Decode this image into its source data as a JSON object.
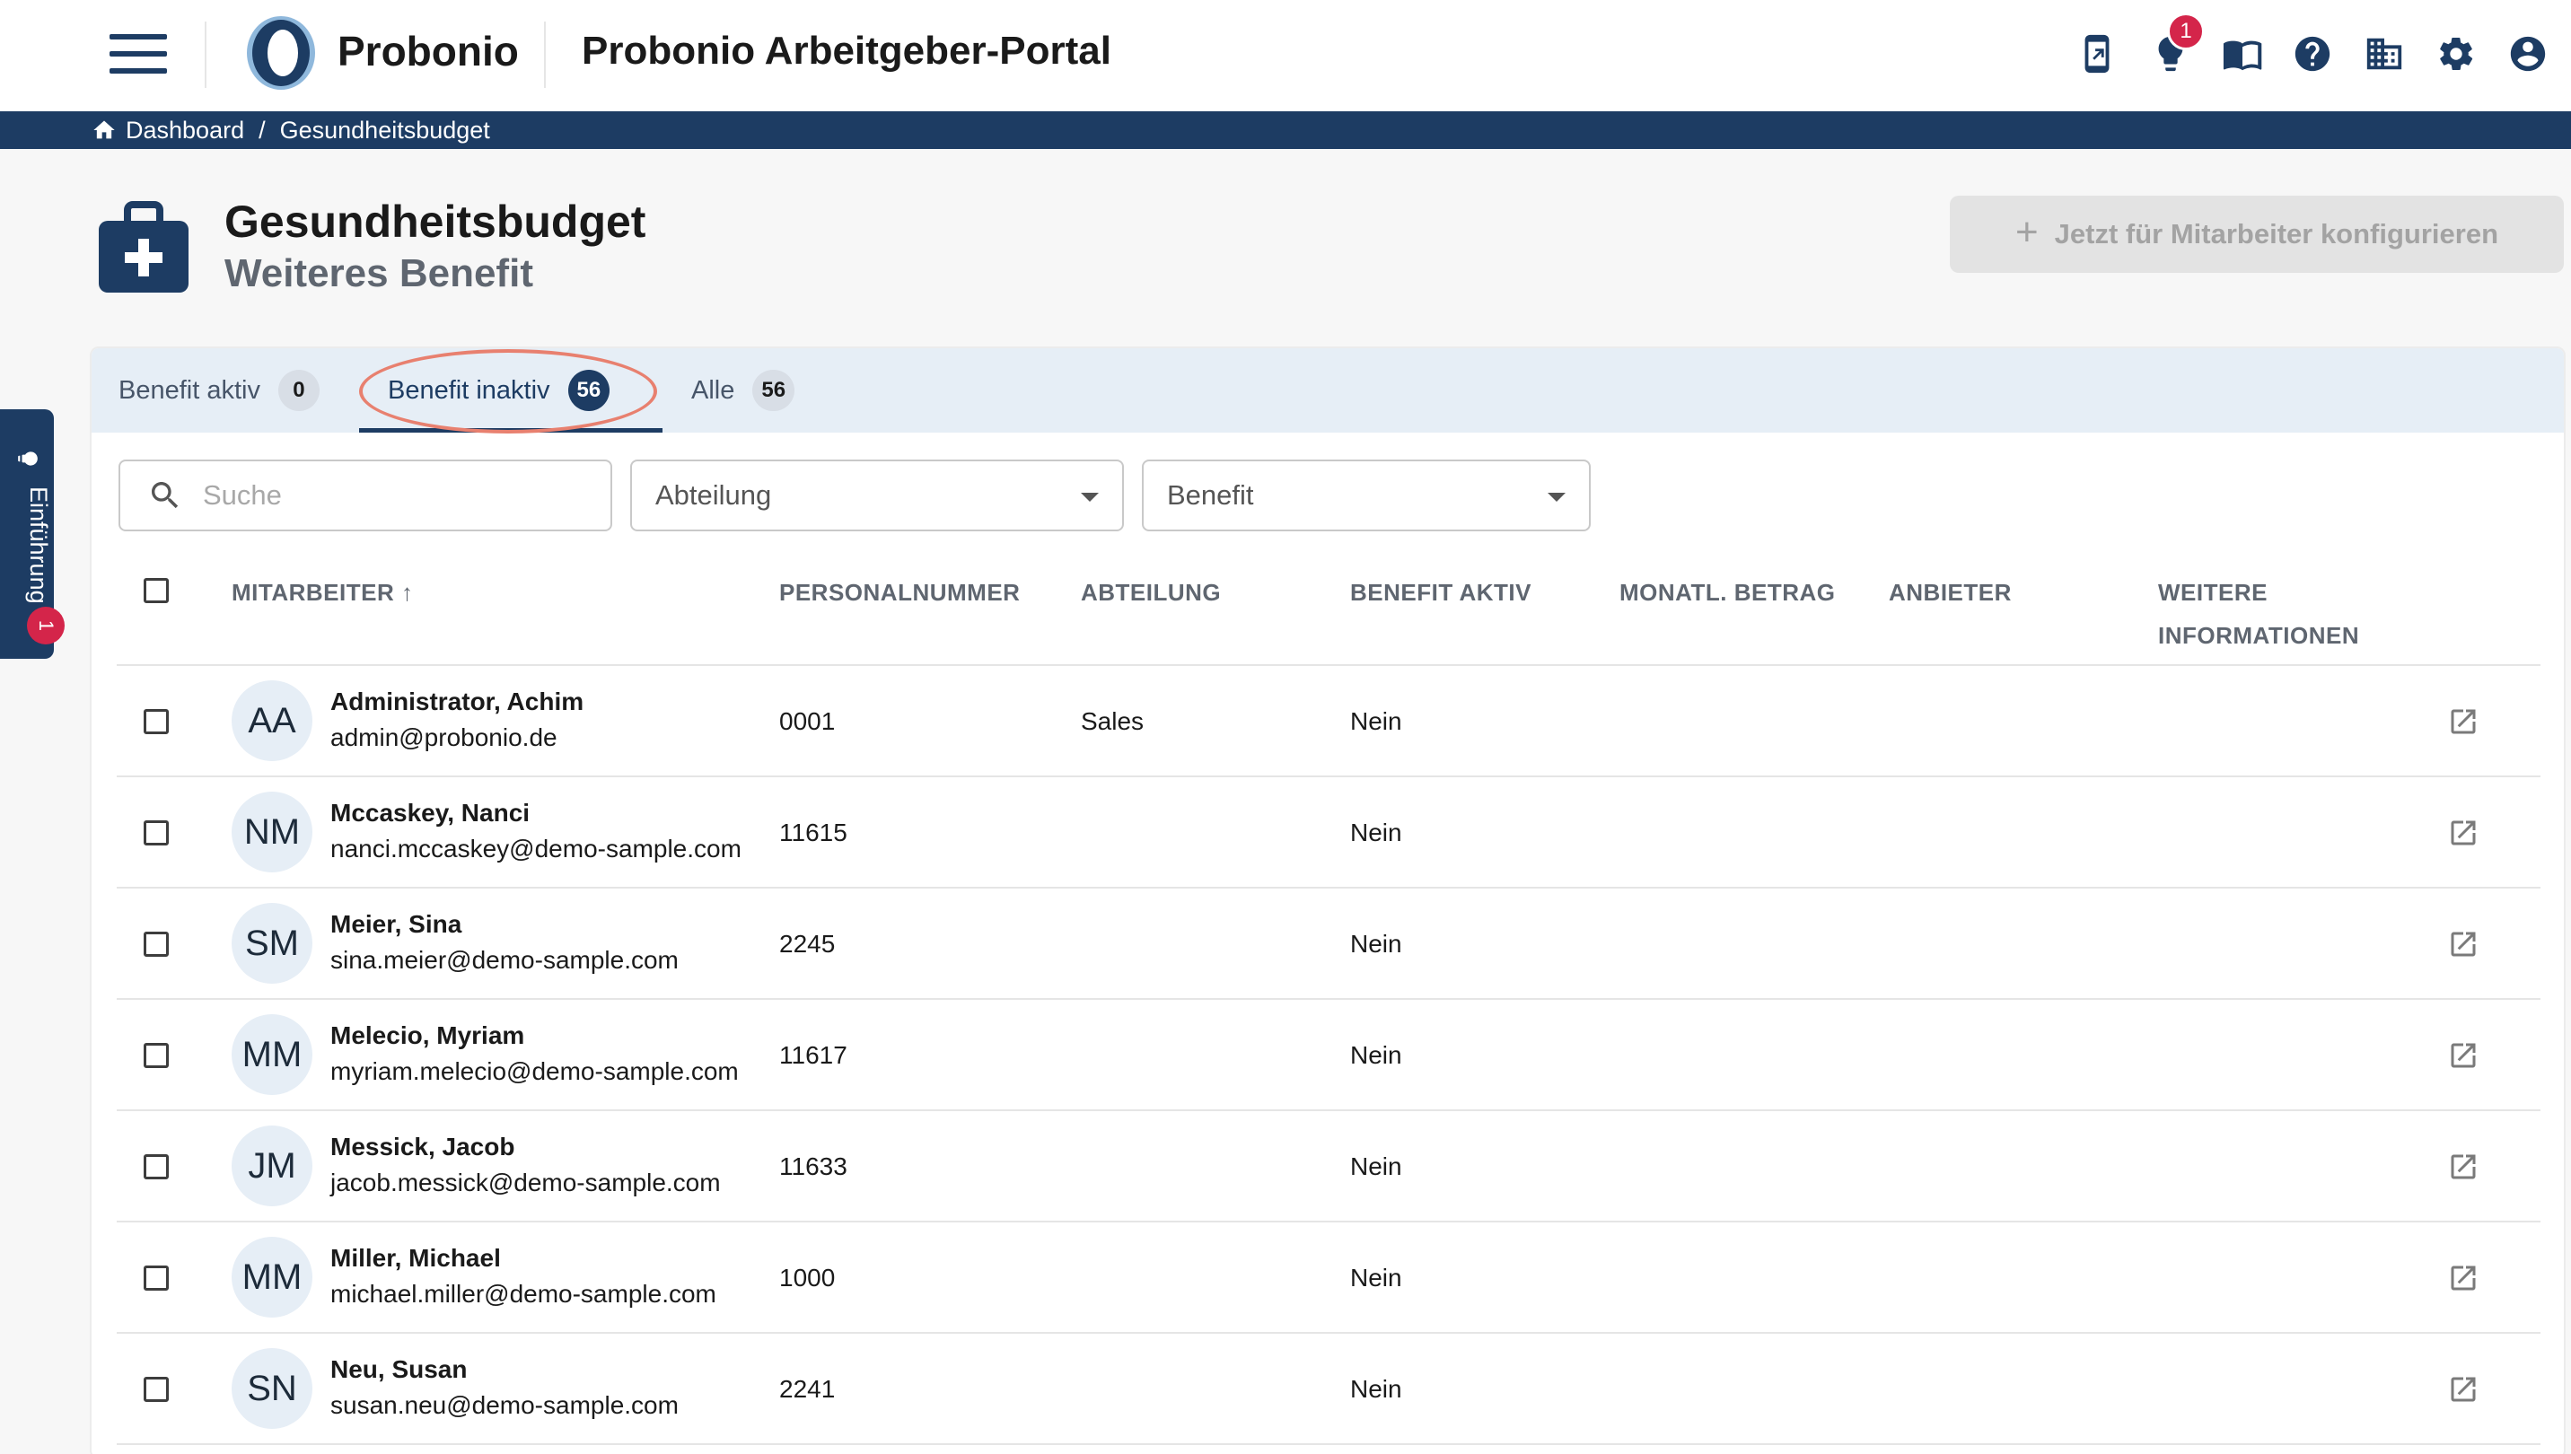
{
  "header": {
    "brand": "Probonio",
    "portal_title": "Probonio Arbeitgeber-Portal",
    "notification_count": "1",
    "icons": [
      "mobile-app-icon",
      "lightbulb-icon",
      "book-icon",
      "help-icon",
      "company-icon",
      "settings-icon",
      "account-icon"
    ]
  },
  "breadcrumb": {
    "home": "Dashboard",
    "separator": "/",
    "current": "Gesundheitsbudget"
  },
  "page": {
    "title": "Gesundheitsbudget",
    "subtitle": "Weiteres Benefit",
    "config_button": "Jetzt für Mitarbeiter konfigurieren",
    "config_button_icon": "+"
  },
  "tabs": [
    {
      "label": "Benefit aktiv",
      "count": "0",
      "active": false
    },
    {
      "label": "Benefit inaktiv",
      "count": "56",
      "active": true
    },
    {
      "label": "Alle",
      "count": "56",
      "active": false
    }
  ],
  "filters": {
    "search_placeholder": "Suche",
    "department": "Abteilung",
    "benefit": "Benefit"
  },
  "table": {
    "columns": [
      "MITARBEITER",
      "PERSONALNUMMER",
      "ABTEILUNG",
      "BENEFIT AKTIV",
      "MONATL. BETRAG",
      "ANBIETER",
      "WEITERE",
      "INFORMATIONEN"
    ],
    "sort_indicator": "↑",
    "rows": [
      {
        "initials": "AA",
        "name": "Administrator, Achim",
        "email": "admin@probonio.de",
        "personal_number": "0001",
        "department": "Sales",
        "benefit_active": "Nein"
      },
      {
        "initials": "NM",
        "name": "Mccaskey, Nanci",
        "email": "nanci.mccaskey@demo-sample.com",
        "personal_number": "11615",
        "department": "",
        "benefit_active": "Nein"
      },
      {
        "initials": "SM",
        "name": "Meier, Sina",
        "email": "sina.meier@demo-sample.com",
        "personal_number": "2245",
        "department": "",
        "benefit_active": "Nein"
      },
      {
        "initials": "MM",
        "name": "Melecio, Myriam",
        "email": "myriam.melecio@demo-sample.com",
        "personal_number": "11617",
        "department": "",
        "benefit_active": "Nein"
      },
      {
        "initials": "JM",
        "name": "Messick, Jacob",
        "email": "jacob.messick@demo-sample.com",
        "personal_number": "11633",
        "department": "",
        "benefit_active": "Nein"
      },
      {
        "initials": "MM",
        "name": "Miller, Michael",
        "email": "michael.miller@demo-sample.com",
        "personal_number": "1000",
        "department": "",
        "benefit_active": "Nein"
      },
      {
        "initials": "SN",
        "name": "Neu, Susan",
        "email": "susan.neu@demo-sample.com",
        "personal_number": "2241",
        "department": "",
        "benefit_active": "Nein"
      }
    ]
  },
  "side_tab": {
    "label": "Einführung",
    "badge": "1"
  },
  "colors": {
    "primary": "#1d3c63",
    "badge": "#d4254a",
    "tab_background": "#e6eef6",
    "highlight_ellipse": "#e8806f"
  }
}
